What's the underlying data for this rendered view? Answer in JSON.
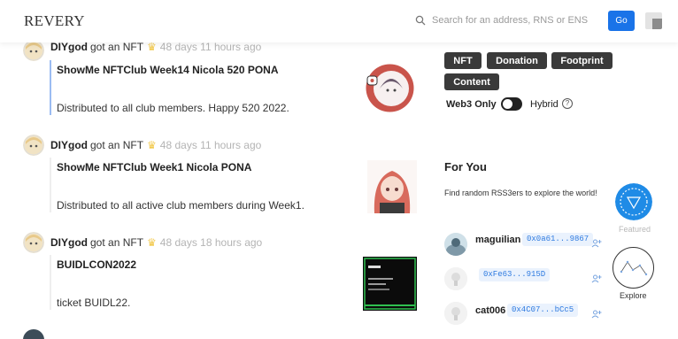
{
  "header": {
    "logo": "REVERY",
    "search_placeholder": "Search for an address, RNS or ENS",
    "go_label": "Go"
  },
  "feed": [
    {
      "user": "DIYgod",
      "action": "got an NFT",
      "time": "48 days 11 hours ago",
      "title": "ShowMe NFTClub Week14 Nicola 520 PONA",
      "description": "Distributed to all club members. Happy 520 2022."
    },
    {
      "user": "DIYgod",
      "action": "got an NFT",
      "time": "48 days 11 hours ago",
      "title": "ShowMe NFTClub Week1 Nicola PONA",
      "description": "Distributed to all active club members during Week1."
    },
    {
      "user": "DIYgod",
      "action": "got an NFT",
      "time": "48 days 18 hours ago",
      "title": "BUIDLCON2022",
      "description": "ticket BUIDL22."
    }
  ],
  "filters": {
    "tags": [
      "NFT",
      "Donation",
      "Footprint",
      "Content"
    ],
    "web3_only_label": "Web3 Only",
    "hybrid_label": "Hybrid",
    "help_glyph": "?"
  },
  "for_you": {
    "title": "For You",
    "subtitle": "Find random RSS3ers to explore the world!",
    "recommendations": [
      {
        "name": "maguilian",
        "address": "0x0a61...9867"
      },
      {
        "name": "",
        "address": "0xFe63...915D"
      },
      {
        "name": "cat006",
        "address": "0x4C07...bCc5"
      }
    ]
  },
  "side_badges": {
    "featured_label": "Featured",
    "explore_label": "Explore"
  },
  "colors": {
    "accent": "#1a73e8",
    "tag_bg": "#3a3a3a",
    "address_text": "#2f7be0",
    "address_bg": "#eaf2fd"
  }
}
